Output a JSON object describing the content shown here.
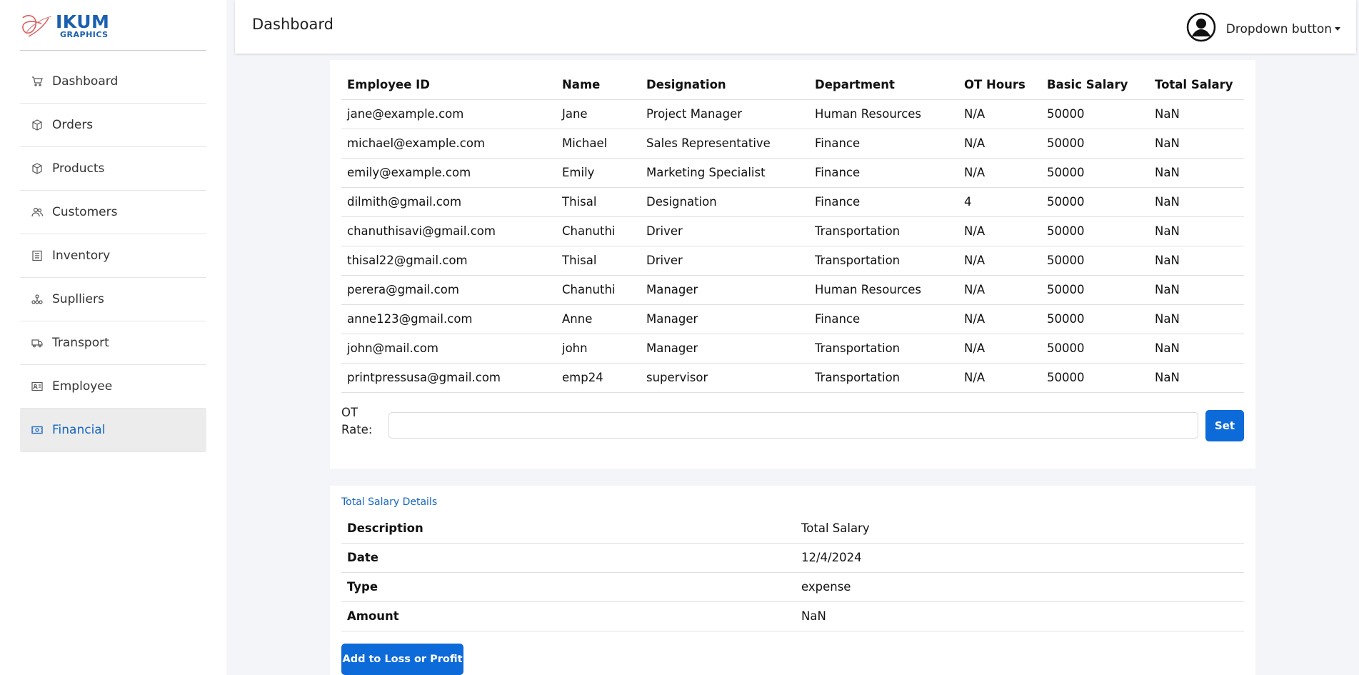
{
  "brand": {
    "name": "IKUM",
    "sub": "GRAPHICS",
    "color": "#1b5fb0"
  },
  "sidebar": {
    "items": [
      {
        "label": "Dashboard",
        "icon": "cart-icon"
      },
      {
        "label": "Orders",
        "icon": "box-icon"
      },
      {
        "label": "Products",
        "icon": "box-icon"
      },
      {
        "label": "Customers",
        "icon": "users-icon"
      },
      {
        "label": "Inventory",
        "icon": "inventory-icon"
      },
      {
        "label": "Suplliers",
        "icon": "suppliers-icon"
      },
      {
        "label": "Transport",
        "icon": "truck-icon"
      },
      {
        "label": "Employee",
        "icon": "id-card-icon"
      },
      {
        "label": "Financial",
        "icon": "cash-icon",
        "active": true
      }
    ]
  },
  "header": {
    "title": "Dashboard",
    "dropdown_label": "Dropdown button"
  },
  "employees": {
    "columns": [
      "Employee ID",
      "Name",
      "Designation",
      "Department",
      "OT Hours",
      "Basic Salary",
      "Total Salary"
    ],
    "rows": [
      [
        "jane@example.com",
        "Jane",
        "Project Manager",
        "Human Resources",
        "N/A",
        "50000",
        "NaN"
      ],
      [
        "michael@example.com",
        "Michael",
        "Sales Representative",
        "Finance",
        "N/A",
        "50000",
        "NaN"
      ],
      [
        "emily@example.com",
        "Emily",
        "Marketing Specialist",
        "Finance",
        "N/A",
        "50000",
        "NaN"
      ],
      [
        "dilmith@gmail.com",
        "Thisal",
        "Designation",
        "Finance",
        "4",
        "50000",
        "NaN"
      ],
      [
        "chanuthisavi@gmail.com",
        "Chanuthi",
        "Driver",
        "Transportation",
        "N/A",
        "50000",
        "NaN"
      ],
      [
        "thisal22@gmail.com",
        "Thisal",
        "Driver",
        "Transportation",
        "N/A",
        "50000",
        "NaN"
      ],
      [
        "perera@gmail.com",
        "Chanuthi",
        "Manager",
        "Human Resources",
        "N/A",
        "50000",
        "NaN"
      ],
      [
        "anne123@gmail.com",
        "Anne",
        "Manager",
        "Finance",
        "N/A",
        "50000",
        "NaN"
      ],
      [
        "john@mail.com",
        "john",
        "Manager",
        "Transportation",
        "N/A",
        "50000",
        "NaN"
      ],
      [
        "printpressusa@gmail.com",
        "emp24",
        "supervisor",
        "Transportation",
        "N/A",
        "50000",
        "NaN"
      ]
    ]
  },
  "ot_rate": {
    "label": "OT Rate:",
    "value": "",
    "button": "Set"
  },
  "salary_details": {
    "title": "Total Salary Details",
    "rows": [
      {
        "key": "Description",
        "value": "Total Salary"
      },
      {
        "key": "Date",
        "value": "12/4/2024"
      },
      {
        "key": "Type",
        "value": "expense"
      },
      {
        "key": "Amount",
        "value": "NaN"
      }
    ],
    "button": "Add to Loss or Profit"
  },
  "colors": {
    "accent": "#0d6ad9",
    "link": "#1565c0"
  }
}
